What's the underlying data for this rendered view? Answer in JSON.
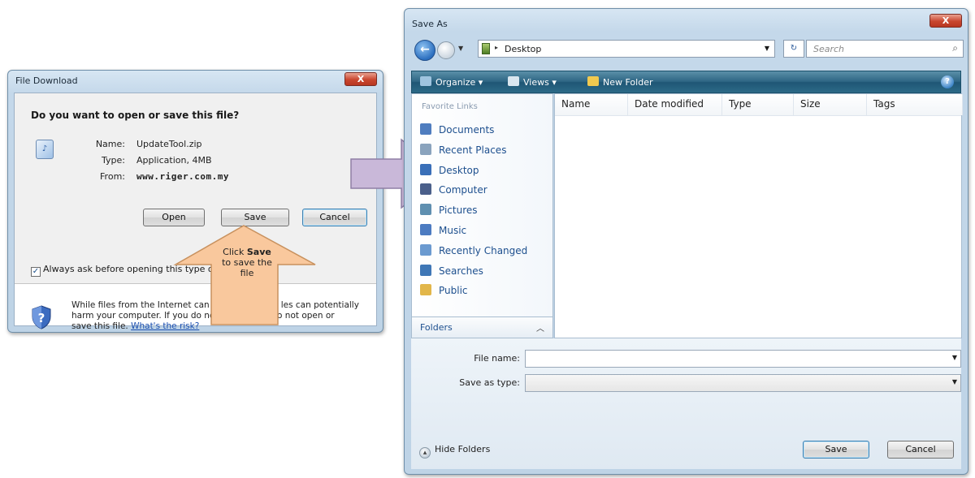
{
  "file_download": {
    "title": "File Download",
    "close_label": "X",
    "question": "Do you want to open or save this file?",
    "file": {
      "name_label": "Name:",
      "name_value": "UpdateTool.zip",
      "type_label": "Type:",
      "type_value": "Application, 4MB",
      "from_label": "From:",
      "from_value": "www.riger.com.my"
    },
    "buttons": {
      "open": "Open",
      "save": "Save",
      "cancel": "Cancel"
    },
    "checkbox_label": "Always ask before opening this type of",
    "checkbox_checked": true,
    "warning_line1": "While files from the Internet can b",
    "warning_line1b": "les can potentially",
    "warning_line2": "harm your computer. If you do no",
    "warning_line2b": "do not open or",
    "warning_line3": "save this file.",
    "warning_link": "What's the risk?"
  },
  "callout": {
    "line1_prefix": "Click",
    "line1_bold": "Save",
    "line2": "to save the",
    "line3": "file",
    "color": "#f9c89d"
  },
  "big_arrow": {
    "color": "#c9b8d9"
  },
  "save_as": {
    "title": "Save As",
    "close_label": "X",
    "address": "Desktop",
    "search_placeholder": "Search",
    "toolbar": {
      "organize": "Organize",
      "views": "Views",
      "new_folder": "New Folder"
    },
    "favorite_links_header": "Favorite Links",
    "nav_items": [
      {
        "label": "Documents",
        "color": "#4f7dbf"
      },
      {
        "label": "Recent Places",
        "color": "#8aa3bd"
      },
      {
        "label": "Desktop",
        "color": "#3a6fb8"
      },
      {
        "label": "Computer",
        "color": "#4a5f8a"
      },
      {
        "label": "Pictures",
        "color": "#5f8fb0"
      },
      {
        "label": "Music",
        "color": "#4c7bc1"
      },
      {
        "label": "Recently Changed",
        "color": "#6b9ad0"
      },
      {
        "label": "Searches",
        "color": "#3f77b6"
      },
      {
        "label": "Public",
        "color": "#e2b64a"
      }
    ],
    "folders_label": "Folders",
    "columns": [
      "Name",
      "Date modified",
      "Type",
      "Size",
      "Tags"
    ],
    "file_name_label": "File name:",
    "file_name_value": "",
    "save_as_type_label": "Save as type:",
    "save_as_type_value": "",
    "hide_folders": "Hide Folders",
    "save_button": "Save",
    "cancel_button": "Cancel"
  }
}
